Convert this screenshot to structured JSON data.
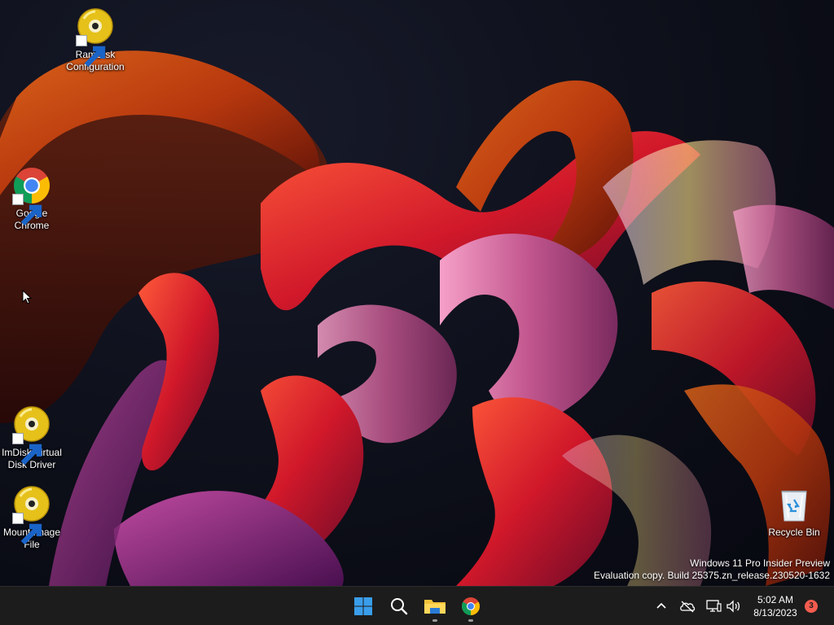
{
  "desktop": {
    "icons": [
      {
        "label": "RamDisk\nConfiguration",
        "icon": "disc-icon"
      },
      {
        "label": "Google\nChrome",
        "icon": "chrome-icon"
      },
      {
        "label": "ImDisk Virtual\nDisk Driver",
        "icon": "disc-icon"
      },
      {
        "label": "Mount Image\nFile",
        "icon": "disc-icon"
      },
      {
        "label": "Recycle Bin",
        "icon": "recycle-bin-icon"
      }
    ],
    "watermark": {
      "line1": "Windows 11 Pro Insider Preview",
      "line2": "Evaluation copy. Build 25375.zn_release.230520-1632"
    }
  },
  "taskbar": {
    "pinned": [
      {
        "name": "start",
        "icon": "windows-logo-icon"
      },
      {
        "name": "search",
        "icon": "search-icon"
      },
      {
        "name": "file-explorer",
        "icon": "folder-icon"
      },
      {
        "name": "chrome",
        "icon": "chrome-icon"
      }
    ],
    "tray": {
      "icons": [
        "chevron-up-icon",
        "onedrive-offline-icon",
        "network-icon",
        "speaker-icon"
      ],
      "time": "5:02 AM",
      "date": "8/13/2023",
      "notification_count": "3"
    }
  },
  "colors": {
    "taskbar_bg": "#1c1c1c",
    "windows_blue": "#3a9eea",
    "badge": "#f25c4f"
  }
}
